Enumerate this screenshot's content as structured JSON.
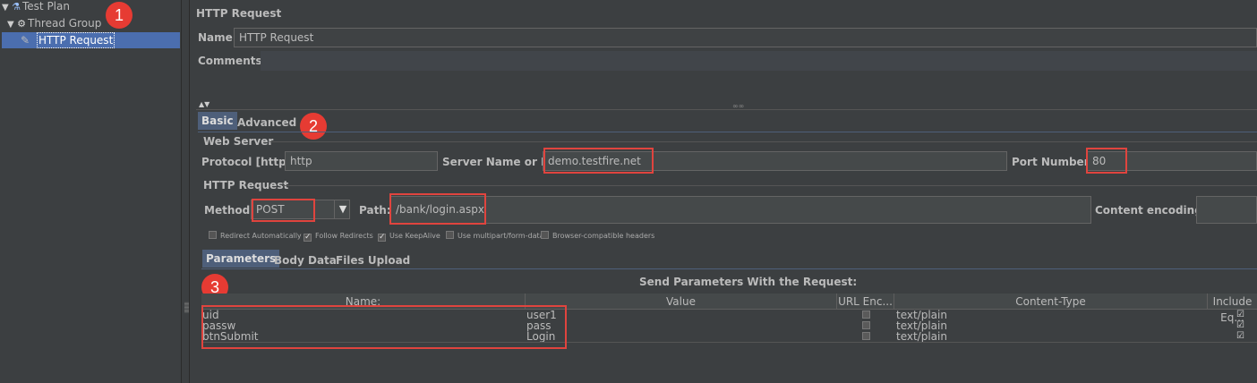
{
  "tree": {
    "items": [
      {
        "label": "Test Plan",
        "icon": "flask-icon"
      },
      {
        "label": "Thread Group",
        "icon": "gear-icon"
      },
      {
        "label": "HTTP Request",
        "icon": "pipette-icon"
      }
    ]
  },
  "badges": [
    "1",
    "2",
    "3"
  ],
  "sampler": {
    "title": "HTTP Request",
    "name_label": "Name:",
    "name_value": "HTTP Request",
    "comments_label": "Comments:"
  },
  "tabs": {
    "basic": "Basic",
    "advanced": "Advanced"
  },
  "web_server": {
    "section": "Web Server",
    "protocol_label": "Protocol [http]:",
    "protocol_value": "http",
    "server_label": "Server Name or IP:",
    "server_value": "demo.testfire.net",
    "port_label": "Port Number:",
    "port_value": "80"
  },
  "http_request": {
    "section": "HTTP Request",
    "method_label": "Method:",
    "method_value": "POST",
    "path_label": "Path:",
    "path_value": "/bank/login.aspx",
    "encoding_label": "Content encoding:"
  },
  "options": [
    {
      "label": "Redirect Automatically",
      "checked": false
    },
    {
      "label": "Follow Redirects",
      "checked": true
    },
    {
      "label": "Use KeepAlive",
      "checked": true
    },
    {
      "label": "Use multipart/form-data",
      "checked": false
    },
    {
      "label": "Browser-compatible headers",
      "checked": false
    }
  ],
  "param_tabs": {
    "parameters": "Parameters",
    "body_data": "Body Data",
    "files_upload": "Files Upload"
  },
  "params_table": {
    "caption": "Send Parameters With the Request:",
    "columns": [
      "Name:",
      "Value",
      "URL Enc...",
      "Content-Type",
      "Include Eq..."
    ],
    "rows": [
      {
        "name": "uid",
        "value": "user1",
        "content_type": "text/plain"
      },
      {
        "name": "passw",
        "value": "pass",
        "content_type": "text/plain"
      },
      {
        "name": "btnSubmit",
        "value": "Login",
        "content_type": "text/plain"
      }
    ]
  },
  "colors": {
    "annotation_red": "#e63b33",
    "selection_blue": "#4b6eaf",
    "background": "#3c3f41"
  }
}
